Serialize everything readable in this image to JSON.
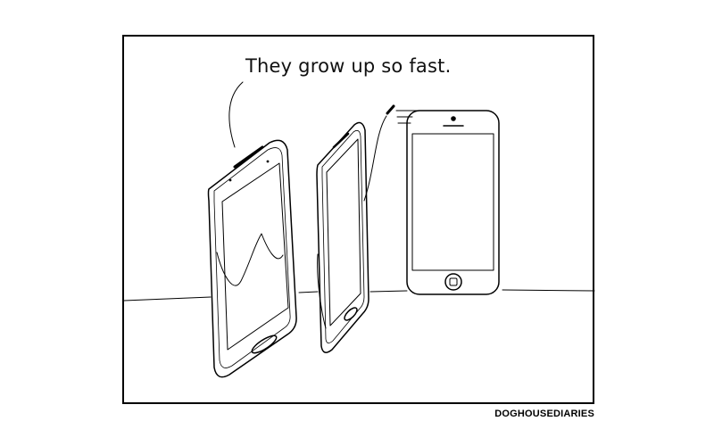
{
  "comic": {
    "speech_text": "They grow up so fast.",
    "credit": "DOGHOUSEDIARIES"
  },
  "characters": {
    "left_phone": "large-phone-icon",
    "middle_phone": "medium-phone-icon",
    "right_phone": "small-phone-icon"
  },
  "colors": {
    "ink": "#000000",
    "paper": "#ffffff"
  }
}
